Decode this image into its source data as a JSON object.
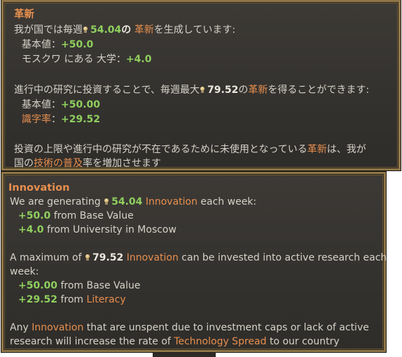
{
  "jp": {
    "title": "革新",
    "gen_prefix": "我が国では毎週",
    "gen_value": "54.04",
    "gen_particle": "の",
    "gen_innov": "革新",
    "gen_suffix": "を生成しています:",
    "base_label": "基本値：",
    "base_value": "+50.0",
    "moscow_label": "モスクワ にある 大学：",
    "moscow_value": "+4.0",
    "invest_prefix": "進行中の研究に投資することで、毎週最大",
    "invest_value": "79.52",
    "invest_particle": "の",
    "invest_innov": "革新",
    "invest_suffix": "を得ることができます:",
    "base2_label": "基本値：",
    "base2_value": "+50.00",
    "literacy_label": "識字率",
    "literacy_colon": "：",
    "literacy_value": "+29.52",
    "unused_prefix": "投資の上限や進行中の研究が不在であるために未使用となっている",
    "unused_innov": "革新",
    "unused_suffix": "は、我が",
    "unused2_prefix": "国の",
    "unused2_tech": "技術の普及",
    "unused2_suffix": "率を増加させます"
  },
  "en": {
    "title": "Innovation",
    "gen_prefix": "We are generating",
    "gen_value": "54.04",
    "gen_innov": "Innovation",
    "gen_suffix": "each week:",
    "base_value": "+50.0",
    "base_label": "from Base Value",
    "moscow_value": "+4.0",
    "moscow_label": "from University in Moscow",
    "invest_prefix": "A maximum of",
    "invest_value": "79.52",
    "invest_innov": "Innovation",
    "invest_suffix": "can be invested into active research each",
    "invest_suffix2": "week:",
    "base2_value": "+50.00",
    "base2_label": "from Base Value",
    "literacy_value": "+29.52",
    "literacy_from": "from",
    "literacy_label": "Literacy",
    "unused_prefix": "Any",
    "unused_innov": "Innovation",
    "unused_suffix": "that are unspent due to investment caps or lack of active",
    "unused2_prefix": "research will increase the rate of",
    "unused2_tech": "Technology Spread",
    "unused2_suffix": "to our country"
  },
  "icons": {
    "innovation": "lightbulb-icon"
  },
  "colors": {
    "highlight": "#e88f4e",
    "positive": "#8fcf5e",
    "border": "#8f7647"
  }
}
